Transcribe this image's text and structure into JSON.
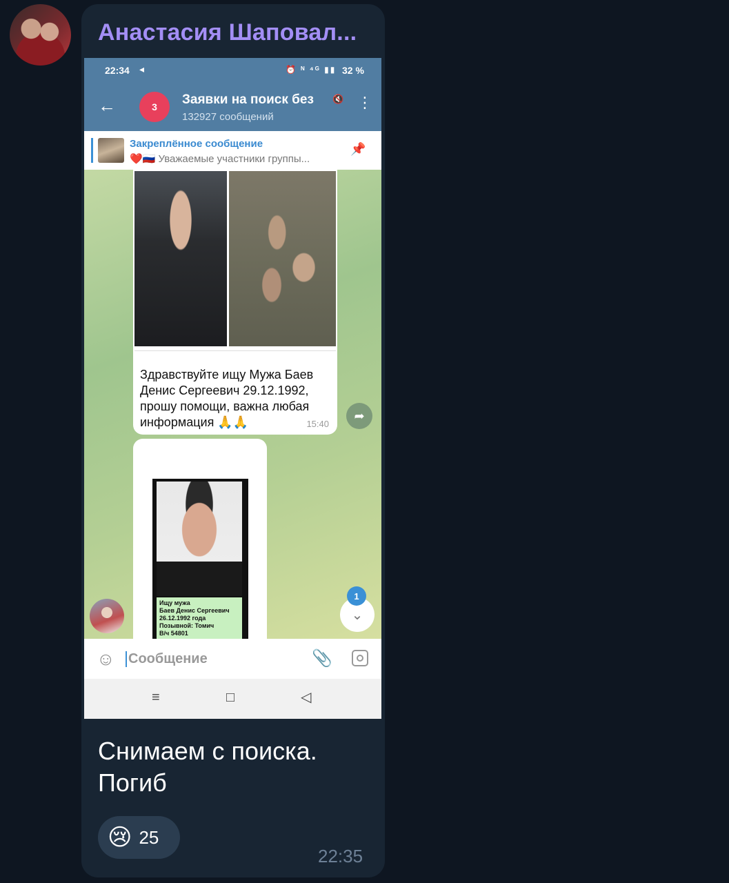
{
  "message": {
    "sender_name": "Анастасия Шаповал...",
    "caption_line1": "Снимаем с поиска.",
    "caption_line2": "Погиб",
    "reaction": {
      "emoji": "😢",
      "count": "25"
    },
    "time": "22:35"
  },
  "screenshot": {
    "statusbar": {
      "time": "22:34",
      "telegram_icon": "◂",
      "icons": "⏰ ᴺ ⁴ᴳ ▮▮",
      "battery": "32 %"
    },
    "appbar": {
      "back": "←",
      "avatar_badge": "3",
      "title": "Заявки на поиск без",
      "subtitle": "132927 сообщений",
      "mute": "🔇",
      "menu": "⋮"
    },
    "pinned": {
      "title": "Закреплённое сообщение",
      "text": "❤️🇷🇺 Уважаемые участники группы...",
      "pin_icon": "📌"
    },
    "msg1": {
      "text": "Здравствуйте ищу Мужа Баев Денис Сергеевич 29.12.1992, прошу помощи, важна любая информация 🙏🙏",
      "time": "15:40"
    },
    "forward_icon": "➦",
    "poster_caption": "Ищу мужа\nБаев Денис Сергеевич\n26.12.1992 года\nПозывной: Томич\nВ/ч 54801",
    "scroll_badge": "1",
    "scroll_icon": "⌄",
    "input": {
      "emoji": "☺",
      "placeholder": "Сообщение",
      "clip": "📎"
    },
    "navbar": {
      "menu": "≡",
      "home": "□",
      "back": "◁"
    }
  }
}
